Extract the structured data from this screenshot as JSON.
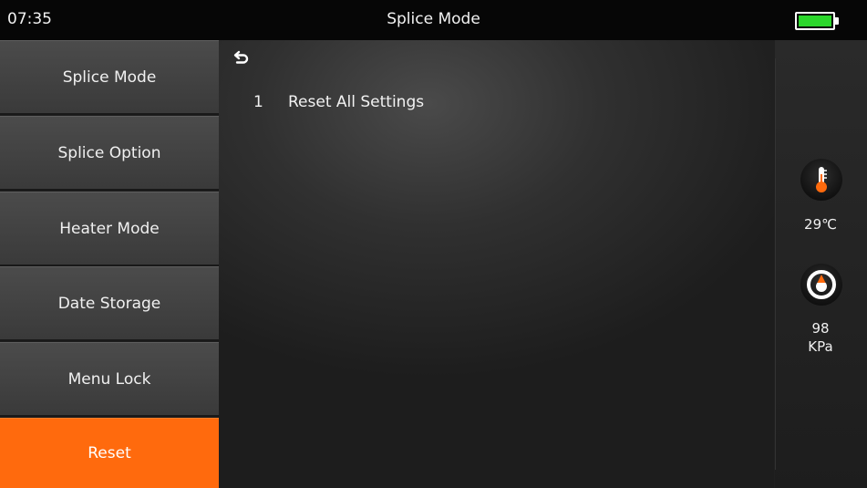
{
  "status_bar": {
    "time": "07:35",
    "title": "Splice Mode",
    "battery_icon": "battery-full-icon",
    "battery_color": "#2bd62b"
  },
  "menu": {
    "items": [
      {
        "label": "Splice Mode"
      },
      {
        "label": "Splice Option"
      },
      {
        "label": "Heater Mode"
      },
      {
        "label": "Date Storage"
      },
      {
        "label": "Menu Lock"
      },
      {
        "label": "Reset"
      }
    ],
    "active_index": 5,
    "active_color": "#ff6a0d"
  },
  "main": {
    "back_icon": "back-arrow-icon",
    "settings": [
      {
        "number": "1",
        "label": "Reset All Settings"
      }
    ]
  },
  "side_panel": {
    "temperature_icon": "thermometer-icon",
    "temperature": "29℃",
    "pressure_icon": "pressure-gauge-icon",
    "pressure_value": "98",
    "pressure_unit": "KPa"
  }
}
